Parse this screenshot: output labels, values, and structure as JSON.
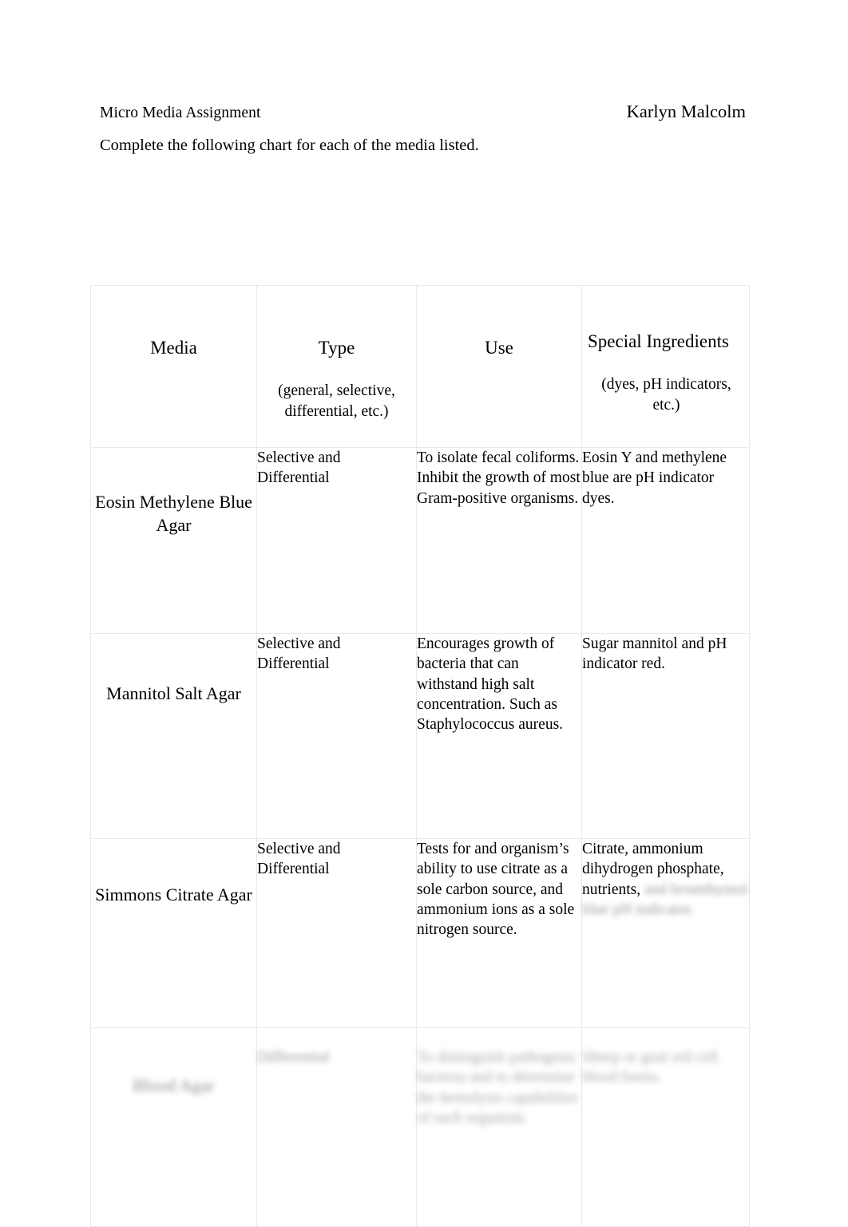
{
  "document": {
    "title": "Micro Media Assignment",
    "author": "Karlyn Malcolm",
    "instruction": "Complete the following chart for each of the media listed."
  },
  "table": {
    "headers": [
      {
        "main": "Media",
        "sub": ""
      },
      {
        "main": "Type",
        "sub": "(general, selective, differential, etc.)"
      },
      {
        "main": "Use",
        "sub": ""
      },
      {
        "main": "Special Ingredients",
        "sub": "(dyes, pH indicators, etc.)"
      }
    ],
    "rows": [
      {
        "media": "Eosin Methylene Blue Agar",
        "type": "Selective and Differential",
        "use": "To isolate fecal coliforms. Inhibit the growth of most Gram-positive organisms.",
        "special": "Eosin Y and methylene blue are pH indicator dyes.",
        "special_faded": ""
      },
      {
        "media": "Mannitol Salt Agar",
        "type": "Selective and Differential",
        "use": "Encourages growth of bacteria that can withstand high salt concentration. Such as Staphylococcus aureus.",
        "special": "Sugar mannitol and pH indicator red.",
        "special_faded": ""
      },
      {
        "media": "Simmons Citrate Agar",
        "type": "Selective and Differential",
        "use": "Tests for and organism’s ability to use citrate as a sole carbon source, and ammonium ions as a sole nitrogen source.",
        "special": "Citrate, ammonium dihydrogen phosphate, nutrients,",
        "special_faded": "and bromthymol blue pH indicator."
      },
      {
        "media": "Blood Agar",
        "type": "Differential",
        "use": "To distinguish pathogenic bacteria and to determine the hemolysis capabilities of each organism.",
        "special": "",
        "special_faded": "Sheep or goat red cell blood forms."
      }
    ]
  }
}
